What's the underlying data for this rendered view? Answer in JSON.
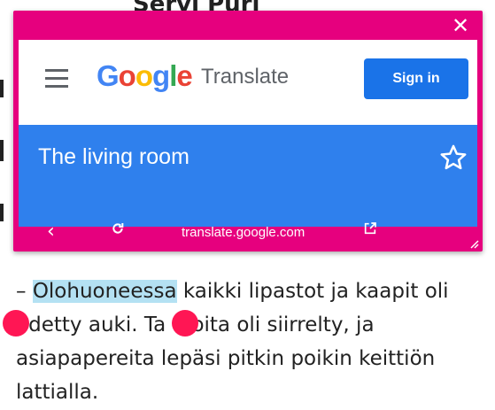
{
  "background": {
    "top_line": "Servi Püri"
  },
  "popup": {
    "close_icon": "close-icon",
    "header": {
      "menu_icon": "hamburger-menu-icon",
      "logo_letters": [
        "G",
        "o",
        "o",
        "g",
        "l",
        "e"
      ],
      "product_name": "Translate",
      "signin_label": "Sign in"
    },
    "result": {
      "text": "The living room",
      "star_icon": "star-outline-icon"
    },
    "bottom_bar": {
      "back_icon": "chevron-left-icon",
      "reload_icon": "reload-icon",
      "url": "translate.google.com",
      "external_icon": "open-external-icon"
    },
    "accent_color": "#e6007e",
    "result_color": "#2f80ed",
    "button_color": "#1a73e8"
  },
  "article": {
    "line1_prefix": "– ",
    "line1_highlight": "Olohuoneessa",
    "line1_rest": " kaikki lipastot ja kaapit oli",
    "line2": "edetty auki. Ta    oita oli siirrelty, ja",
    "line3": "asiapapereita lepäsi pitkin poikin keittiön",
    "line4": "lattialla.",
    "highlight_color": "#b4e1f3",
    "marker_color": "#ff1654"
  }
}
